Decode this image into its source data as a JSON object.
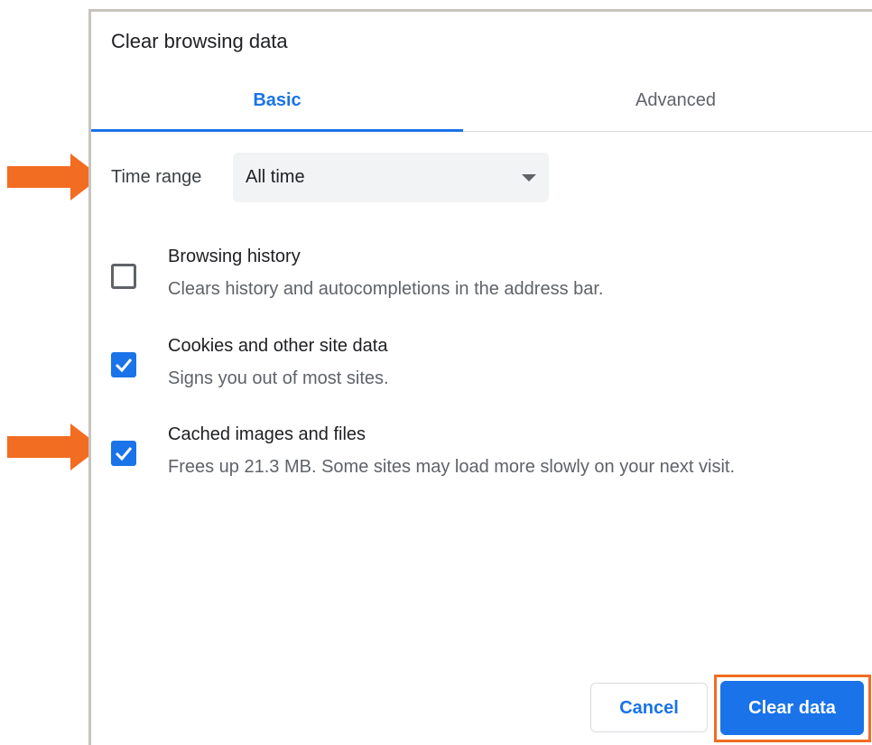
{
  "dialog": {
    "title": "Clear browsing data",
    "tabs": [
      {
        "label": "Basic",
        "active": true
      },
      {
        "label": "Advanced",
        "active": false
      }
    ],
    "time_range": {
      "label": "Time range",
      "selected": "All time"
    },
    "options": [
      {
        "title": "Browsing history",
        "description": "Clears history and autocompletions in the address bar.",
        "checked": false
      },
      {
        "title": "Cookies and other site data",
        "description": "Signs you out of most sites.",
        "checked": true
      },
      {
        "title": "Cached images and files",
        "description": "Frees up 21.3 MB. Some sites may load more slowly on your next visit.",
        "checked": true
      }
    ],
    "buttons": {
      "cancel": "Cancel",
      "clear": "Clear data"
    }
  },
  "colors": {
    "accent": "#1a73e8",
    "annotation": "#f26c22"
  }
}
